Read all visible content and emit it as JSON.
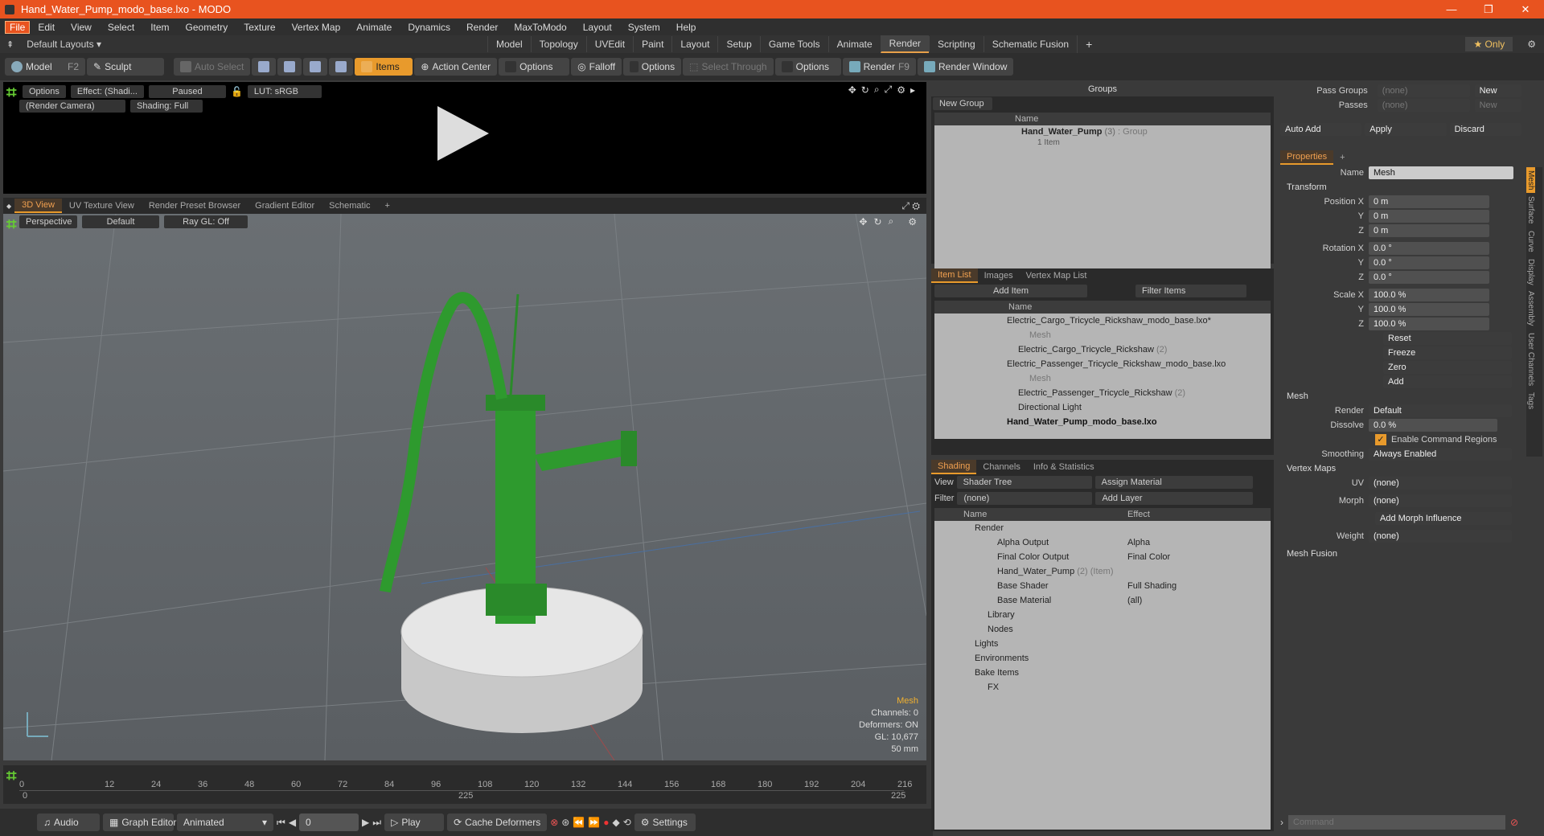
{
  "window": {
    "title": "Hand_Water_Pump_modo_base.lxo - MODO"
  },
  "menu": [
    "File",
    "Edit",
    "View",
    "Select",
    "Item",
    "Geometry",
    "Texture",
    "Vertex Map",
    "Animate",
    "Dynamics",
    "Render",
    "MaxToModo",
    "Layout",
    "System",
    "Help"
  ],
  "layout_bar": {
    "preset": "Default Layouts ▾",
    "tabs": [
      "Model",
      "Topology",
      "UVEdit",
      "Paint",
      "Layout",
      "Setup",
      "Game Tools",
      "Animate",
      "Render",
      "Scripting",
      "Schematic Fusion"
    ],
    "only": "★ Only"
  },
  "toolbar": {
    "model": "Model",
    "model_key": "F2",
    "sculpt": "Sculpt",
    "auto_select": "Auto Select",
    "items": "Items",
    "action_center": "Action Center",
    "options1": "Options",
    "falloff": "Falloff",
    "options2": "Options",
    "select_through": "Select Through",
    "options3": "Options",
    "render": "Render",
    "render_key": "F9",
    "render_window": "Render Window"
  },
  "render_view": {
    "options": "Options",
    "effect": "Effect: (Shadi...",
    "paused": "Paused",
    "lut": "LUT: sRGB",
    "camera": "(Render Camera)",
    "shading": "Shading: Full"
  },
  "view_tabs": [
    "3D View",
    "UV Texture View",
    "Render Preset Browser",
    "Gradient Editor",
    "Schematic"
  ],
  "viewport": {
    "perspective": "Perspective",
    "default": "Default",
    "raygl": "Ray GL: Off",
    "hud": {
      "type": "Mesh",
      "channels": "Channels: 0",
      "deformers": "Deformers: ON",
      "gl": "GL: 10,677",
      "size": "50 mm"
    }
  },
  "timeline": {
    "ticks": [
      "0",
      "12",
      "24",
      "36",
      "48",
      "60",
      "72",
      "84",
      "96",
      "108",
      "120",
      "132",
      "144",
      "156",
      "168",
      "180",
      "192",
      "204",
      "216"
    ],
    "start": "0",
    "end": "225",
    "mid": "225"
  },
  "bottom": {
    "audio": "Audio",
    "graph_editor": "Graph Editor",
    "animated": "Animated",
    "frame": "0",
    "play": "Play",
    "cache": "Cache Deformers",
    "settings": "Settings"
  },
  "groups": {
    "title": "Groups",
    "new_group": "New Group",
    "col_name": "Name",
    "item_name": "Hand_Water_Pump",
    "item_count": "(3)",
    "item_type": ": Group",
    "item_sub": "1 Item"
  },
  "item_list": {
    "tabs": [
      "Item List",
      "Images",
      "Vertex Map List"
    ],
    "add_item": "Add Item",
    "filter": "Filter Items",
    "col_name": "Name",
    "rows": [
      {
        "label": "Electric_Cargo_Tricycle_Rickshaw_modo_base.lxo*",
        "indent": 0,
        "dim": false,
        "bold": false
      },
      {
        "label": "Mesh",
        "indent": 2,
        "dim": true,
        "bold": false
      },
      {
        "label": "Electric_Cargo_Tricycle_Rickshaw",
        "extra": "(2)",
        "indent": 1,
        "dim": false,
        "bold": false
      },
      {
        "label": "Electric_Passenger_Tricycle_Rickshaw_modo_base.lxo",
        "indent": 0,
        "dim": false,
        "bold": false
      },
      {
        "label": "Mesh",
        "indent": 2,
        "dim": true,
        "bold": false
      },
      {
        "label": "Electric_Passenger_Tricycle_Rickshaw",
        "extra": "(2)",
        "indent": 1,
        "dim": false,
        "bold": false
      },
      {
        "label": "Directional Light",
        "indent": 1,
        "dim": false,
        "bold": false
      },
      {
        "label": "Hand_Water_Pump_modo_base.lxo",
        "indent": 0,
        "dim": false,
        "bold": true
      }
    ]
  },
  "shading": {
    "tabs": [
      "Shading",
      "Channels",
      "Info & Statistics"
    ],
    "view_label": "View",
    "view_value": "Shader Tree",
    "assign": "Assign Material",
    "filter_label": "Filter",
    "filter_value": "(none)",
    "add_layer": "Add Layer",
    "col_name": "Name",
    "col_effect": "Effect",
    "rows": [
      {
        "label": "Render",
        "effect": "",
        "indent": 0
      },
      {
        "label": "Alpha Output",
        "effect": "Alpha",
        "indent": 1
      },
      {
        "label": "Final Color Output",
        "effect": "Final Color",
        "indent": 1
      },
      {
        "label": "Hand_Water_Pump",
        "extra": "(2) (Item)",
        "effect": "",
        "indent": 1
      },
      {
        "label": "Base Shader",
        "effect": "Full Shading",
        "indent": 1
      },
      {
        "label": "Base Material",
        "effect": "(all)",
        "indent": 1
      },
      {
        "label": "Library",
        "effect": "",
        "indent": 1
      },
      {
        "label": "Nodes",
        "effect": "",
        "indent": 1
      },
      {
        "label": "Lights",
        "effect": "",
        "indent": 0
      },
      {
        "label": "Environments",
        "effect": "",
        "indent": 0
      },
      {
        "label": "Bake Items",
        "effect": "",
        "indent": 0
      },
      {
        "label": "FX",
        "effect": "",
        "indent": 0
      }
    ]
  },
  "passes": {
    "pass_groups": "Pass Groups",
    "passes": "Passes",
    "none": "(none)",
    "new": "New",
    "auto_add": "Auto Add",
    "apply": "Apply",
    "discard": "Discard"
  },
  "properties": {
    "tab": "Properties",
    "name_label": "Name",
    "name_value": "Mesh",
    "transform": "Transform",
    "pos_label": "Position X",
    "y": "Y",
    "z": "Z",
    "pos": [
      "0 m",
      "0 m",
      "0 m"
    ],
    "rot_label": "Rotation X",
    "rot": [
      "0.0 °",
      "0.0 °",
      "0.0 °"
    ],
    "scale_label": "Scale X",
    "scale": [
      "100.0 %",
      "100.0 %",
      "100.0 %"
    ],
    "reset": "Reset",
    "freeze": "Freeze",
    "zero": "Zero",
    "add": "Add",
    "mesh_sec": "Mesh",
    "render_label": "Render",
    "render_value": "Default",
    "dissolve_label": "Dissolve",
    "dissolve_value": "0.0 %",
    "enable_cmd": "Enable Command Regions",
    "smoothing_label": "Smoothing",
    "smoothing_value": "Always Enabled",
    "vmaps": "Vertex Maps",
    "uv_label": "UV",
    "uv_value": "(none)",
    "morph_label": "Morph",
    "morph_value": "(none)",
    "add_morph": "Add Morph Influence",
    "weight_label": "Weight",
    "weight_value": "(none)",
    "mesh_fusion": "Mesh Fusion",
    "side_tabs": [
      "Mesh",
      "Surface",
      "Curve",
      "Display",
      "Assembly",
      "User Channels",
      "Tags"
    ]
  },
  "command": {
    "placeholder": "Command"
  }
}
